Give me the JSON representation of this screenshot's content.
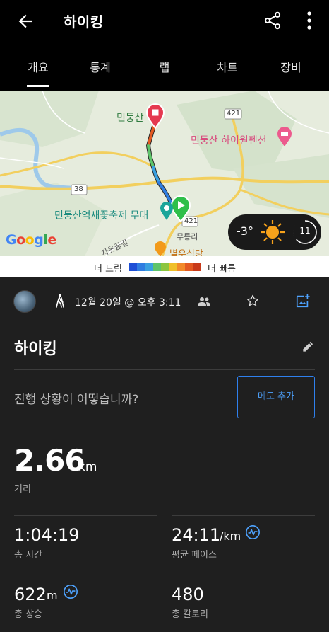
{
  "appbar": {
    "title": "하이킹",
    "back_icon": "arrow-left-icon",
    "share_icon": "share-icon",
    "more_icon": "more-vert-icon"
  },
  "tabs": [
    {
      "label": "개요",
      "active": true
    },
    {
      "label": "통계",
      "active": false
    },
    {
      "label": "랩",
      "active": false
    },
    {
      "label": "차트",
      "active": false
    },
    {
      "label": "장비",
      "active": false
    }
  ],
  "map": {
    "labels": {
      "mountain": "민둥산",
      "pension": "민둥산 하이원펜션",
      "festival": "민둥산억새꽃축제 무대",
      "village": "무릉리",
      "road": "자옷골길",
      "food": "별우식당",
      "route421": "421",
      "route38": "38",
      "route421b": "421"
    },
    "google_logo": "Google",
    "weather": {
      "temp": "-3°",
      "moon_day": "11"
    }
  },
  "legend": {
    "slow": "더 느림",
    "fast": "더 빠름",
    "colors": [
      "#1e4fd6",
      "#2f7de1",
      "#3aa0e0",
      "#5ec46a",
      "#8cc63f",
      "#f0c02a",
      "#f28a2a",
      "#e35a22",
      "#c83a1a"
    ]
  },
  "activity": {
    "datetime": "12월 20일 @ 오후 3:11",
    "title": "하이킹",
    "question": "진행 상황이 어떻습니까?",
    "memo_button": "메모 추가"
  },
  "stats": {
    "distance": {
      "value": "2.66",
      "unit": "km",
      "label": "거리"
    },
    "total_time": {
      "value": "1:04:19",
      "label": "총 시간"
    },
    "avg_pace": {
      "value": "24:11",
      "unit": "/km",
      "label": "평균 페이스"
    },
    "total_ascent": {
      "value": "622",
      "unit": "m",
      "label": "총 상승"
    },
    "calories": {
      "value": "480",
      "label": "총 칼로리"
    }
  },
  "colors": {
    "accent": "#2f80ed",
    "background": "#1f1f1f",
    "header": "#000000"
  }
}
